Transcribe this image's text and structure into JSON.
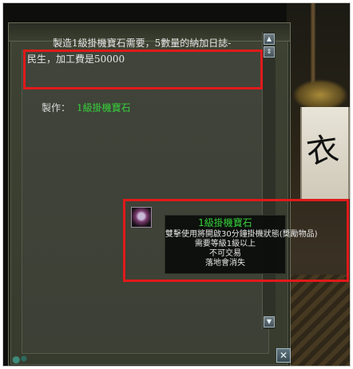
{
  "craft_dialog": {
    "description_line1": "製造1級掛機寶石需要，5數量的納加日誌-",
    "description_line2": "民生，加工費是50000",
    "make_label": "製作：",
    "make_item": "1級掛機寶石",
    "close_label": "✕"
  },
  "tooltip": {
    "title": "1級掛機寶石",
    "lines": [
      "雙擊使用將開啟30分鐘掛機狀態(獎勵物品)",
      "需要等級1級以上",
      "不可交易",
      "落地會消失"
    ]
  },
  "scrollbar": {
    "up_glyph": "▲",
    "mid_glyph": "⇕",
    "down_glyph": "▼"
  },
  "banner_glyph": "衣",
  "colors": {
    "highlight": "#e01a1a",
    "item_name": "#35d13a",
    "window_bg": "#3e4233"
  }
}
